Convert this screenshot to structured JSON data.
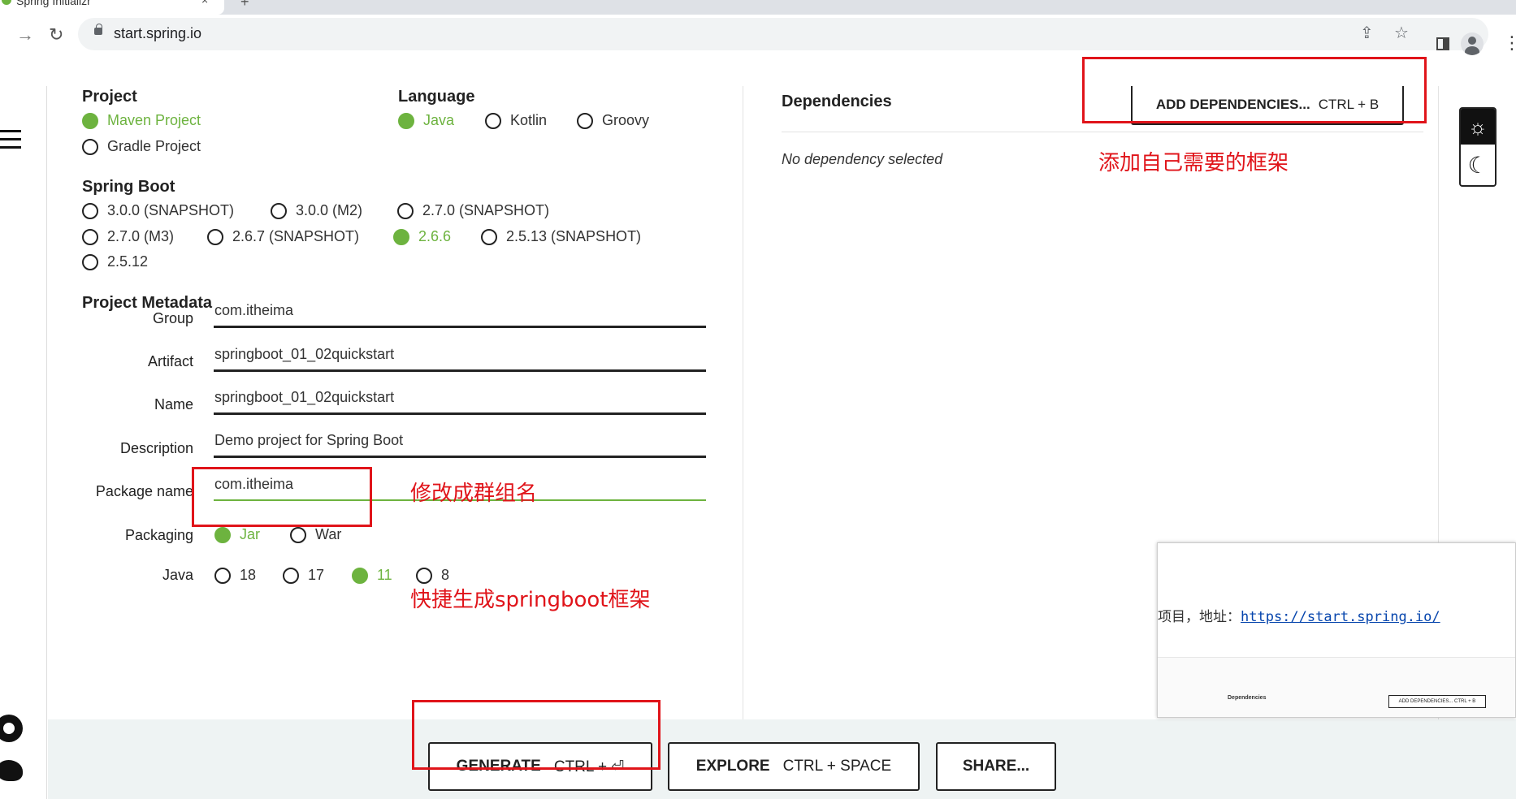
{
  "browser": {
    "tab_title": "Spring Initializr",
    "tab_close": "×",
    "new_tab": "+",
    "window_minimize": "—",
    "url": "start.spring.io",
    "icons": [
      "back-forward-icon",
      "reload-icon",
      "lock-icon",
      "share-icon",
      "star-icon",
      "side-panel-icon",
      "profile-icon",
      "menu-icon"
    ]
  },
  "project": {
    "title": "Project",
    "options": [
      {
        "label": "Maven Project",
        "selected": true
      },
      {
        "label": "Gradle Project",
        "selected": false
      }
    ]
  },
  "language": {
    "title": "Language",
    "options": [
      {
        "label": "Java",
        "selected": true
      },
      {
        "label": "Kotlin",
        "selected": false
      },
      {
        "label": "Groovy",
        "selected": false
      }
    ]
  },
  "spring_boot": {
    "title": "Spring Boot",
    "options": [
      {
        "label": "3.0.0 (SNAPSHOT)",
        "selected": false
      },
      {
        "label": "3.0.0 (M2)",
        "selected": false
      },
      {
        "label": "2.7.0 (SNAPSHOT)",
        "selected": false
      },
      {
        "label": "2.7.0 (M3)",
        "selected": false
      },
      {
        "label": "2.6.7 (SNAPSHOT)",
        "selected": false
      },
      {
        "label": "2.6.6",
        "selected": true
      },
      {
        "label": "2.5.13 (SNAPSHOT)",
        "selected": false
      },
      {
        "label": "2.5.12",
        "selected": false
      }
    ]
  },
  "metadata": {
    "title": "Project Metadata",
    "fields": [
      {
        "label": "Group",
        "value": "com.itheima"
      },
      {
        "label": "Artifact",
        "value": "springboot_01_02quickstart"
      },
      {
        "label": "Name",
        "value": "springboot_01_02quickstart"
      },
      {
        "label": "Description",
        "value": "Demo project for Spring Boot"
      },
      {
        "label": "Package name",
        "value": "com.itheima"
      }
    ],
    "packaging": {
      "label": "Packaging",
      "options": [
        {
          "label": "Jar",
          "selected": true
        },
        {
          "label": "War",
          "selected": false
        }
      ]
    },
    "java": {
      "label": "Java",
      "options": [
        {
          "label": "18",
          "selected": false
        },
        {
          "label": "17",
          "selected": false
        },
        {
          "label": "11",
          "selected": true
        },
        {
          "label": "8",
          "selected": false
        }
      ]
    }
  },
  "dependencies": {
    "title": "Dependencies",
    "add_button": {
      "label": "ADD DEPENDENCIES...",
      "shortcut": "CTRL + B"
    },
    "empty": "No dependency selected"
  },
  "theme": {
    "light_icon": "☼",
    "dark_icon": "☾"
  },
  "footer": {
    "generate": {
      "label": "GENERATE",
      "shortcut": "CTRL + ⏎"
    },
    "explore": {
      "label": "EXPLORE",
      "shortcut": "CTRL + SPACE"
    },
    "share": {
      "label": "SHARE..."
    }
  },
  "thumbnail": {
    "text_prefix": "项目，地址：",
    "link": "https://start.spring.io/",
    "deps_title": "Dependencies",
    "button": "ADD DEPENDENCIES...  CTRL + B"
  },
  "annotations": {
    "add_deps": "添加自己需要的框架",
    "package": "修改成群组名",
    "generate": "快捷生成springboot框架"
  },
  "colors": {
    "accent": "#6db33f",
    "annotation": "#e0141a",
    "footer_bg": "#eef3f3"
  }
}
